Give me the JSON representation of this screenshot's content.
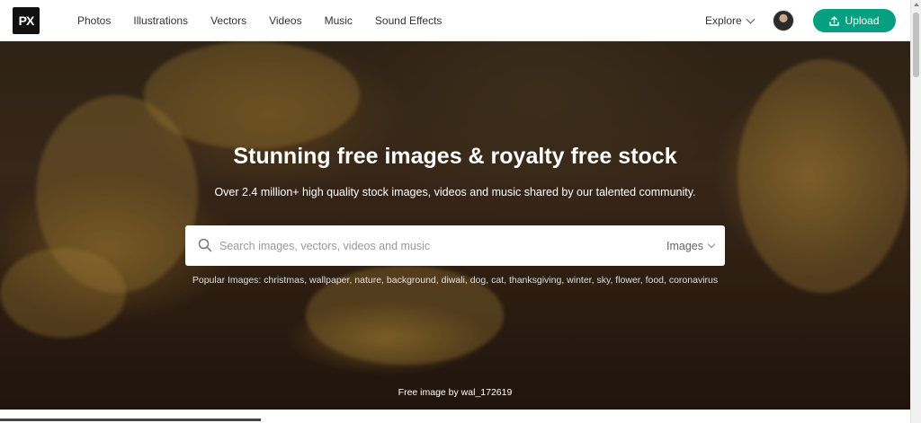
{
  "header": {
    "logo_text": "PX",
    "nav": [
      "Photos",
      "Illustrations",
      "Vectors",
      "Videos",
      "Music",
      "Sound Effects"
    ],
    "explore_label": "Explore",
    "upload_label": "Upload",
    "accent_color": "#05a081"
  },
  "hero": {
    "headline": "Stunning free images & royalty free stock",
    "subline": "Over 2.4 million+ high quality stock images, videos and music shared by our talented community.",
    "search": {
      "placeholder": "Search images, vectors, videos and music",
      "type_selected": "Images"
    },
    "popular": {
      "label": "Popular Images:",
      "tags": [
        "christmas",
        "wallpaper",
        "nature",
        "background",
        "diwali",
        "dog",
        "cat",
        "thanksgiving",
        "winter",
        "sky",
        "flower",
        "food",
        "coronavirus"
      ]
    },
    "credit": "Free image by wal_172619"
  }
}
